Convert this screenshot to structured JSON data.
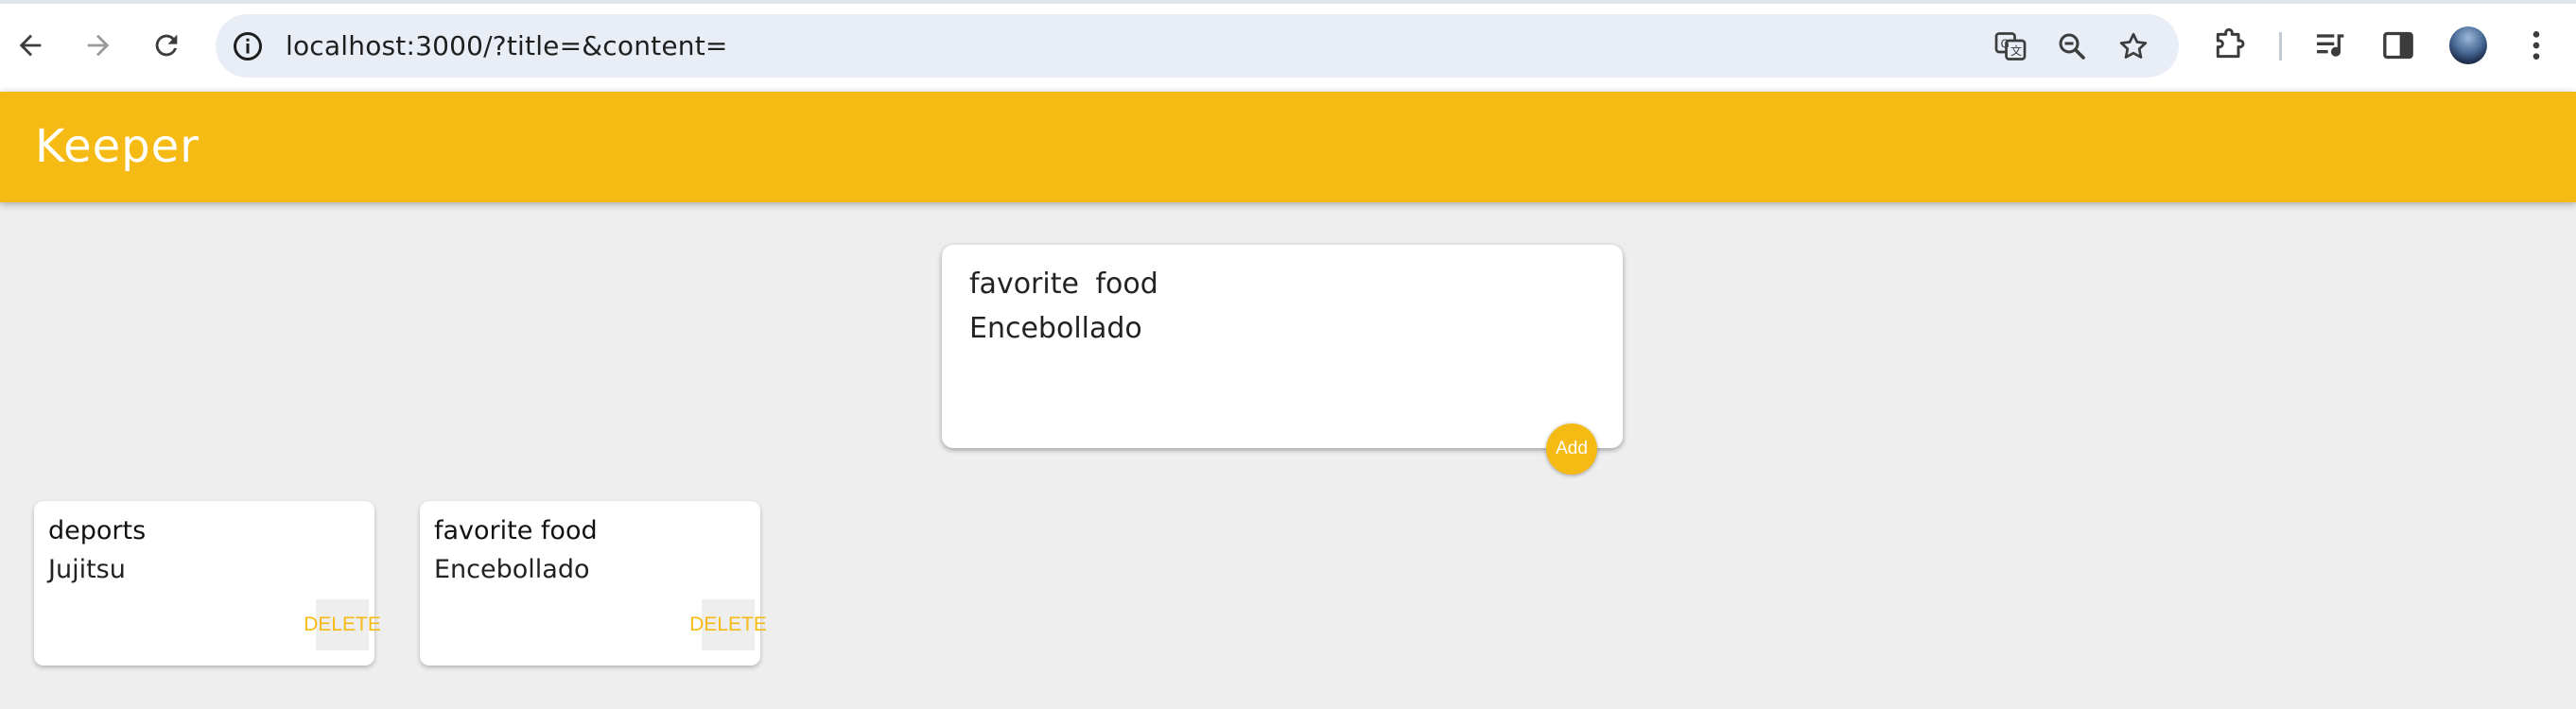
{
  "browser": {
    "url": "localhost:3000/?title=&content=",
    "icons": {
      "back": "arrow-left-icon",
      "forward": "arrow-right-icon",
      "reload": "reload-icon",
      "site_info": "info-icon",
      "translate": "translate-icon",
      "zoom": "zoom-out-icon",
      "bookmark": "star-icon",
      "extensions": "puzzle-icon",
      "media": "media-queue-icon",
      "side_panel": "side-panel-icon",
      "profile": "avatar",
      "menu": "kebab-menu-icon"
    }
  },
  "app": {
    "title": "Keeper",
    "accent_color": "#f5ba13",
    "background_color": "#eeeeee"
  },
  "create_form": {
    "title_value": "favorite  food",
    "content_value": "Encebollado",
    "add_label": "Add"
  },
  "notes": [
    {
      "title": "deports",
      "content": "Jujitsu",
      "delete_label": "DELETE"
    },
    {
      "title": "favorite food",
      "content": "Encebollado",
      "delete_label": "DELETE"
    }
  ]
}
